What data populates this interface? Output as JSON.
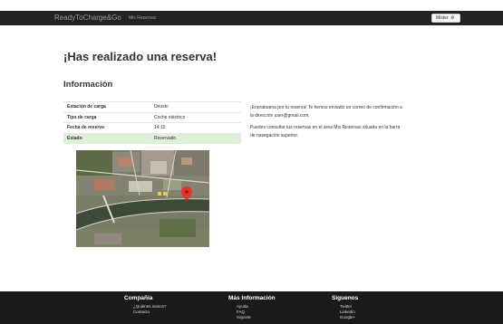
{
  "navbar": {
    "brand": "ReadyToCharge&Go",
    "link": "Mis Reservas",
    "user_button": "Mister",
    "user_icon": "gear-icon"
  },
  "page": {
    "title": "¡Has realizado una reserva!",
    "section_title": "Información"
  },
  "details": {
    "rows": [
      {
        "label": "Estación de carga",
        "value": "Deusto"
      },
      {
        "label": "Tipo de carga",
        "value": "Coche eléctrico"
      },
      {
        "label": "Fecha de reserva",
        "value": "14:15"
      },
      {
        "label": "Estado",
        "value": "Reservado"
      }
    ]
  },
  "message": {
    "p1": "¡Enorabuena por tu reserva! Te hemos enviado un correo de confirmación a la dirección user@gmail.com.",
    "p2": "Puedes consultar tus reservas en el área Mis Reservas situada en la barra de navegación superior."
  },
  "colors": {
    "navbar_bg": "#222222",
    "success_row": "#dff0d8",
    "footer_bg": "#1a1a1a",
    "map_pin": "#e5322d"
  },
  "footer": {
    "columns": [
      {
        "title": "Compañía",
        "links": [
          "¿Quiénes somos?",
          "Contacto"
        ]
      },
      {
        "title": "Más Información",
        "links": [
          "Ayuda",
          "FAQ",
          "Soporte"
        ]
      },
      {
        "title": "Síguenos",
        "links": [
          "Twitter",
          "Linkedin",
          "Google+"
        ]
      }
    ]
  }
}
